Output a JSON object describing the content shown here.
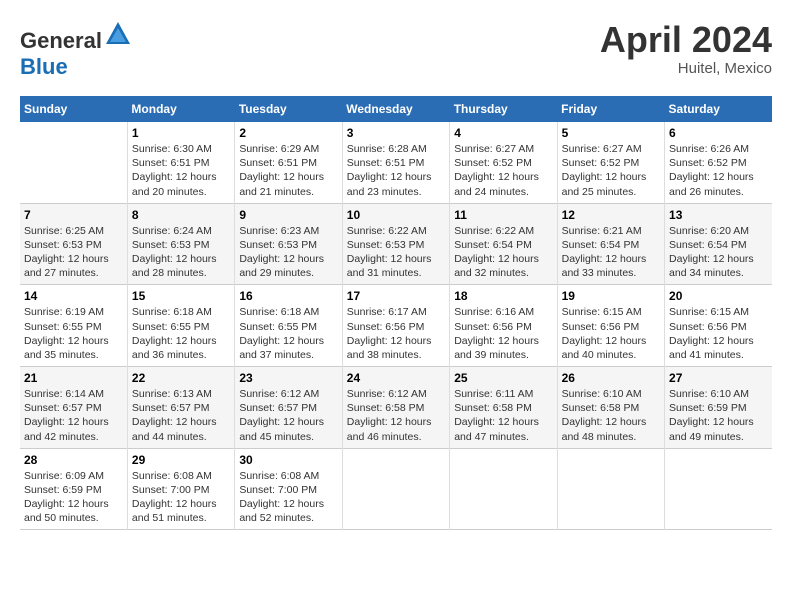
{
  "header": {
    "logo_general": "General",
    "logo_blue": "Blue",
    "month_year": "April 2024",
    "location": "Huitel, Mexico"
  },
  "weekdays": [
    "Sunday",
    "Monday",
    "Tuesday",
    "Wednesday",
    "Thursday",
    "Friday",
    "Saturday"
  ],
  "weeks": [
    [
      {
        "day": "",
        "info": ""
      },
      {
        "day": "1",
        "info": "Sunrise: 6:30 AM\nSunset: 6:51 PM\nDaylight: 12 hours\nand 20 minutes."
      },
      {
        "day": "2",
        "info": "Sunrise: 6:29 AM\nSunset: 6:51 PM\nDaylight: 12 hours\nand 21 minutes."
      },
      {
        "day": "3",
        "info": "Sunrise: 6:28 AM\nSunset: 6:51 PM\nDaylight: 12 hours\nand 23 minutes."
      },
      {
        "day": "4",
        "info": "Sunrise: 6:27 AM\nSunset: 6:52 PM\nDaylight: 12 hours\nand 24 minutes."
      },
      {
        "day": "5",
        "info": "Sunrise: 6:27 AM\nSunset: 6:52 PM\nDaylight: 12 hours\nand 25 minutes."
      },
      {
        "day": "6",
        "info": "Sunrise: 6:26 AM\nSunset: 6:52 PM\nDaylight: 12 hours\nand 26 minutes."
      }
    ],
    [
      {
        "day": "7",
        "info": "Sunrise: 6:25 AM\nSunset: 6:53 PM\nDaylight: 12 hours\nand 27 minutes."
      },
      {
        "day": "8",
        "info": "Sunrise: 6:24 AM\nSunset: 6:53 PM\nDaylight: 12 hours\nand 28 minutes."
      },
      {
        "day": "9",
        "info": "Sunrise: 6:23 AM\nSunset: 6:53 PM\nDaylight: 12 hours\nand 29 minutes."
      },
      {
        "day": "10",
        "info": "Sunrise: 6:22 AM\nSunset: 6:53 PM\nDaylight: 12 hours\nand 31 minutes."
      },
      {
        "day": "11",
        "info": "Sunrise: 6:22 AM\nSunset: 6:54 PM\nDaylight: 12 hours\nand 32 minutes."
      },
      {
        "day": "12",
        "info": "Sunrise: 6:21 AM\nSunset: 6:54 PM\nDaylight: 12 hours\nand 33 minutes."
      },
      {
        "day": "13",
        "info": "Sunrise: 6:20 AM\nSunset: 6:54 PM\nDaylight: 12 hours\nand 34 minutes."
      }
    ],
    [
      {
        "day": "14",
        "info": "Sunrise: 6:19 AM\nSunset: 6:55 PM\nDaylight: 12 hours\nand 35 minutes."
      },
      {
        "day": "15",
        "info": "Sunrise: 6:18 AM\nSunset: 6:55 PM\nDaylight: 12 hours\nand 36 minutes."
      },
      {
        "day": "16",
        "info": "Sunrise: 6:18 AM\nSunset: 6:55 PM\nDaylight: 12 hours\nand 37 minutes."
      },
      {
        "day": "17",
        "info": "Sunrise: 6:17 AM\nSunset: 6:56 PM\nDaylight: 12 hours\nand 38 minutes."
      },
      {
        "day": "18",
        "info": "Sunrise: 6:16 AM\nSunset: 6:56 PM\nDaylight: 12 hours\nand 39 minutes."
      },
      {
        "day": "19",
        "info": "Sunrise: 6:15 AM\nSunset: 6:56 PM\nDaylight: 12 hours\nand 40 minutes."
      },
      {
        "day": "20",
        "info": "Sunrise: 6:15 AM\nSunset: 6:56 PM\nDaylight: 12 hours\nand 41 minutes."
      }
    ],
    [
      {
        "day": "21",
        "info": "Sunrise: 6:14 AM\nSunset: 6:57 PM\nDaylight: 12 hours\nand 42 minutes."
      },
      {
        "day": "22",
        "info": "Sunrise: 6:13 AM\nSunset: 6:57 PM\nDaylight: 12 hours\nand 44 minutes."
      },
      {
        "day": "23",
        "info": "Sunrise: 6:12 AM\nSunset: 6:57 PM\nDaylight: 12 hours\nand 45 minutes."
      },
      {
        "day": "24",
        "info": "Sunrise: 6:12 AM\nSunset: 6:58 PM\nDaylight: 12 hours\nand 46 minutes."
      },
      {
        "day": "25",
        "info": "Sunrise: 6:11 AM\nSunset: 6:58 PM\nDaylight: 12 hours\nand 47 minutes."
      },
      {
        "day": "26",
        "info": "Sunrise: 6:10 AM\nSunset: 6:58 PM\nDaylight: 12 hours\nand 48 minutes."
      },
      {
        "day": "27",
        "info": "Sunrise: 6:10 AM\nSunset: 6:59 PM\nDaylight: 12 hours\nand 49 minutes."
      }
    ],
    [
      {
        "day": "28",
        "info": "Sunrise: 6:09 AM\nSunset: 6:59 PM\nDaylight: 12 hours\nand 50 minutes."
      },
      {
        "day": "29",
        "info": "Sunrise: 6:08 AM\nSunset: 7:00 PM\nDaylight: 12 hours\nand 51 minutes."
      },
      {
        "day": "30",
        "info": "Sunrise: 6:08 AM\nSunset: 7:00 PM\nDaylight: 12 hours\nand 52 minutes."
      },
      {
        "day": "",
        "info": ""
      },
      {
        "day": "",
        "info": ""
      },
      {
        "day": "",
        "info": ""
      },
      {
        "day": "",
        "info": ""
      }
    ]
  ]
}
